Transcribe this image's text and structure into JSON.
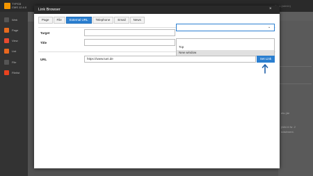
{
  "app": {
    "brand": "TYPO3 CMS 12.4.0",
    "user_area": "Pres (admin)",
    "sidebar": [
      {
        "label": "Web",
        "icon": "web-icon",
        "color": "#555555"
      },
      {
        "label": "Page",
        "icon": "page-icon",
        "color": "#e96b1f"
      },
      {
        "label": "View",
        "icon": "view-icon",
        "color": "#e94b2f"
      },
      {
        "label": "List",
        "icon": "list-icon",
        "color": "#e9671f"
      },
      {
        "label": "File",
        "icon": "file-icon",
        "color": "#555555"
      },
      {
        "label": "Filelist",
        "icon": "filelist-icon",
        "color": "#e9431f"
      }
    ],
    "background_text": [
      "ets (de",
      "(684 6 Nr. 2",
      "ndsément."
    ]
  },
  "modal": {
    "title": "Link Browser",
    "close_label": "×",
    "tabs": [
      "Page",
      "File",
      "External URL",
      "Telephone",
      "Email",
      "News"
    ],
    "active_tab": "External URL",
    "fields": {
      "target_label": "Target",
      "title_label": "Title",
      "url_label": "URL",
      "target_value": "",
      "title_value": "",
      "url_value": "https://www.tuei.de"
    },
    "target_dropdown": {
      "chevron": "⌄",
      "options": [
        "Top",
        "New window"
      ],
      "highlighted": "New window"
    },
    "set_link_label": "Set Link"
  },
  "colors": {
    "accent": "#2b7fd0",
    "modal_header": "#292929"
  }
}
